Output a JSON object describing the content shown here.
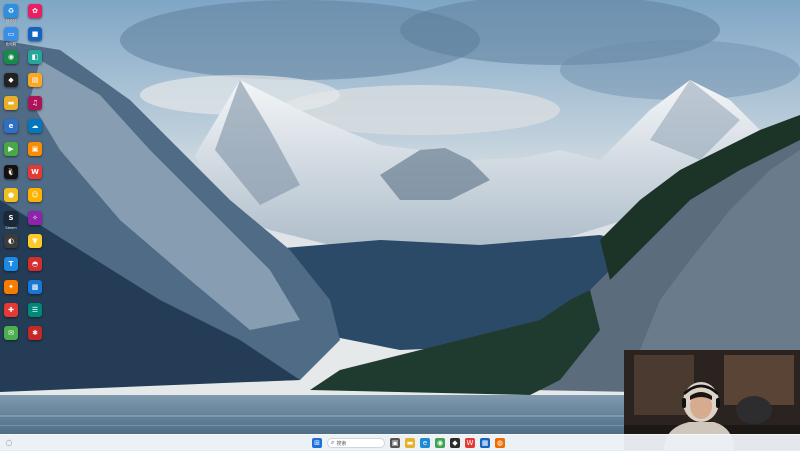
{
  "desktop": {
    "icons": [
      {
        "label": "回收站",
        "color": "#2f8fdc",
        "glyph": "♻",
        "icon": "recycle-bin-icon"
      },
      {
        "label": "此电脑",
        "color": "#3a8ee6",
        "glyph": "▭",
        "icon": "computer-icon"
      },
      {
        "label": "",
        "color": "#1a8a4a",
        "glyph": "◉",
        "icon": "app-icon"
      },
      {
        "label": "",
        "color": "#222222",
        "glyph": "◆",
        "icon": "game-icon"
      },
      {
        "label": "",
        "color": "#e8b02a",
        "glyph": "▬",
        "icon": "folder-icon"
      },
      {
        "label": "",
        "color": "#2f6fc4",
        "glyph": "e",
        "icon": "edge-icon"
      },
      {
        "label": "",
        "color": "#46a846",
        "glyph": "▶",
        "icon": "nvidia-icon"
      },
      {
        "label": "",
        "color": "#111111",
        "glyph": "🐧",
        "icon": "qq-icon"
      },
      {
        "label": "",
        "color": "#f0c020",
        "glyph": "●",
        "icon": "app-icon"
      },
      {
        "label": "Steam",
        "color": "#1b2838",
        "glyph": "S",
        "icon": "steam-icon"
      },
      {
        "label": "",
        "color": "#3c3c3c",
        "glyph": "◐",
        "icon": "obs-icon"
      },
      {
        "label": "",
        "color": "#1e88e5",
        "glyph": "T",
        "icon": "todesk-icon"
      },
      {
        "label": "",
        "color": "#f57c00",
        "glyph": "✦",
        "icon": "app-icon"
      },
      {
        "label": "",
        "color": "#e53935",
        "glyph": "✚",
        "icon": "app-icon"
      },
      {
        "label": "",
        "color": "#4caf50",
        "glyph": "✉",
        "icon": "wechat-icon"
      },
      {
        "label": "",
        "color": "#e91e63",
        "glyph": "✿",
        "icon": "app-icon"
      },
      {
        "label": "",
        "color": "#1565c0",
        "glyph": "■",
        "icon": "app-icon"
      },
      {
        "label": "",
        "color": "#26a69a",
        "glyph": "◧",
        "icon": "app-icon"
      },
      {
        "label": "",
        "color": "#f9a825",
        "glyph": "▤",
        "icon": "app-icon"
      },
      {
        "label": "",
        "color": "#ad1457",
        "glyph": "♫",
        "icon": "app-icon"
      },
      {
        "label": "",
        "color": "#0277bd",
        "glyph": "☁",
        "icon": "app-icon"
      },
      {
        "label": "",
        "color": "#fb8c00",
        "glyph": "▣",
        "icon": "app-icon"
      },
      {
        "label": "",
        "color": "#e53935",
        "glyph": "W",
        "icon": "wps-icon"
      },
      {
        "label": "",
        "color": "#ffb300",
        "glyph": "☺",
        "icon": "app-icon"
      },
      {
        "label": "",
        "color": "#8e24aa",
        "glyph": "✧",
        "icon": "app-icon"
      },
      {
        "label": "",
        "color": "#ffca28",
        "glyph": "▼",
        "icon": "app-icon"
      },
      {
        "label": "",
        "color": "#d32f2f",
        "glyph": "◓",
        "icon": "app-icon"
      },
      {
        "label": "",
        "color": "#1976d2",
        "glyph": "▩",
        "icon": "app-icon"
      },
      {
        "label": "",
        "color": "#00897b",
        "glyph": "☰",
        "icon": "app-icon"
      },
      {
        "label": "",
        "color": "#c62828",
        "glyph": "✱",
        "icon": "app-icon"
      }
    ]
  },
  "taskbar": {
    "search_label": "搜索",
    "apps": [
      {
        "icon": "windows-start-icon",
        "color": "#1e6fd9",
        "glyph": "⊞"
      },
      {
        "icon": "task-view-icon",
        "color": "#555555",
        "glyph": "▣"
      },
      {
        "icon": "file-explorer-icon",
        "color": "#e8b02a",
        "glyph": "▬"
      },
      {
        "icon": "edge-icon",
        "color": "#1f8ad4",
        "glyph": "e"
      },
      {
        "icon": "chrome-icon",
        "color": "#3fa34d",
        "glyph": "◉"
      },
      {
        "icon": "app-icon",
        "color": "#2b2b2b",
        "glyph": "◆"
      },
      {
        "icon": "wps-icon",
        "color": "#e53935",
        "glyph": "W"
      },
      {
        "icon": "app-icon",
        "color": "#1565c0",
        "glyph": "▦"
      },
      {
        "icon": "app-icon",
        "color": "#ef6c00",
        "glyph": "◍"
      }
    ]
  },
  "colors": {
    "sky_top": "#8fb3cf",
    "lake": "#5d7d98",
    "taskbar": "#ecf0f6"
  }
}
